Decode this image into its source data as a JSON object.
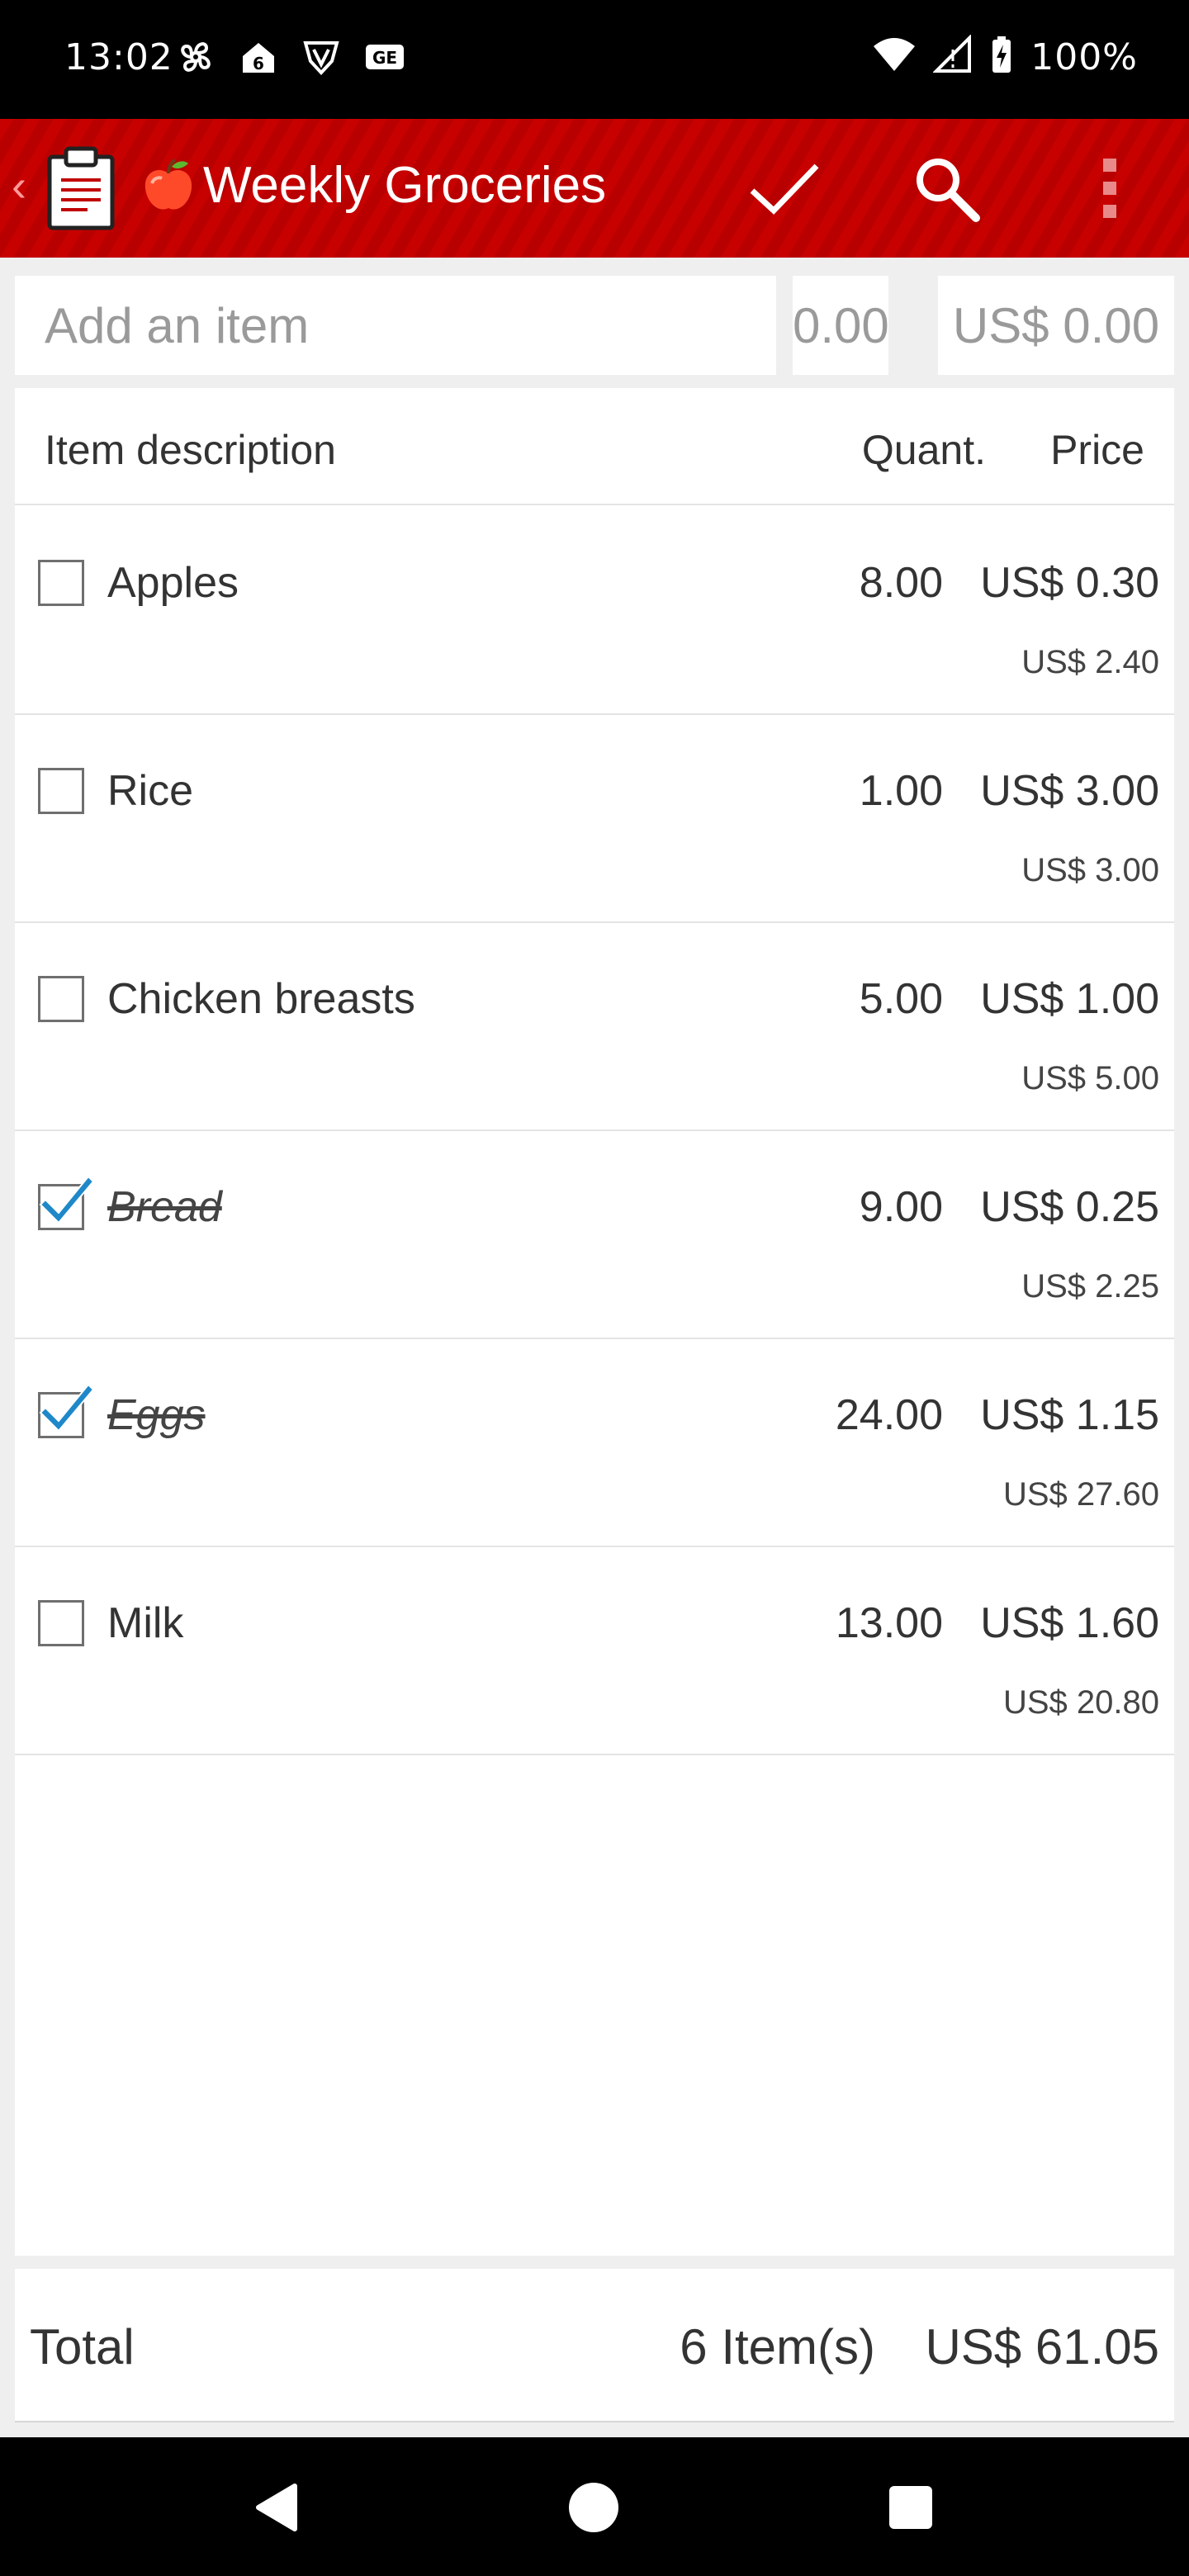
{
  "status_bar": {
    "time": "13:02",
    "battery": "100%",
    "icons_left": [
      "pinwheel-icon",
      "home-6-icon",
      "shield-v-icon",
      "ge-icon"
    ],
    "icons_right": [
      "wifi-icon",
      "signal-icon",
      "battery-charging-icon"
    ]
  },
  "app_bar": {
    "title": "Weekly Groceries",
    "title_emoji": "apple-icon",
    "background": "#c00000",
    "actions": [
      "check-icon",
      "search-icon",
      "more-vert-icon"
    ]
  },
  "add_row": {
    "item_placeholder": "Add an item",
    "quantity_placeholder": "0.00",
    "price_placeholder": "US$ 0.00"
  },
  "list": {
    "headers": {
      "description": "Item description",
      "quantity": "Quant.",
      "price": "Price"
    },
    "items": [
      {
        "name": "Apples",
        "checked": false,
        "quantity": "8.00",
        "price": "US$ 0.30",
        "subtotal": "US$ 2.40"
      },
      {
        "name": "Rice",
        "checked": false,
        "quantity": "1.00",
        "price": "US$ 3.00",
        "subtotal": "US$ 3.00"
      },
      {
        "name": "Chicken breasts",
        "checked": false,
        "quantity": "5.00",
        "price": "US$ 1.00",
        "subtotal": "US$ 5.00"
      },
      {
        "name": "Bread",
        "checked": true,
        "quantity": "9.00",
        "price": "US$ 0.25",
        "subtotal": "US$ 2.25"
      },
      {
        "name": "Eggs",
        "checked": true,
        "quantity": "24.00",
        "price": "US$ 1.15",
        "subtotal": "US$ 27.60"
      },
      {
        "name": "Milk",
        "checked": false,
        "quantity": "13.00",
        "price": "US$ 1.60",
        "subtotal": "US$ 20.80"
      }
    ]
  },
  "total": {
    "label": "Total",
    "count": "6 Item(s)",
    "amount": "US$ 61.05"
  },
  "colors": {
    "accent": "#c00000",
    "check": "#1e88c9"
  }
}
